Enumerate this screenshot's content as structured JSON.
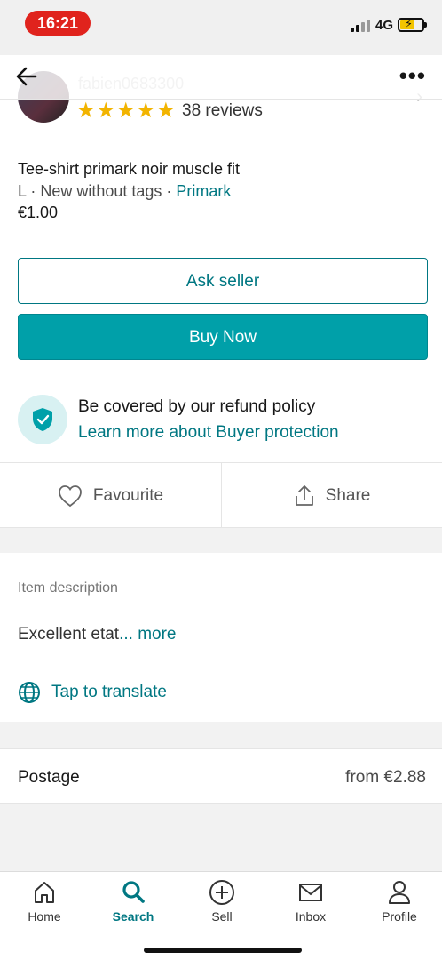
{
  "status": {
    "time": "16:21",
    "network": "4G"
  },
  "seller": {
    "username": "fabien0683300",
    "stars": "★★★★★",
    "reviews": "38 reviews"
  },
  "item": {
    "title": "Tee-shirt primark noir muscle fit",
    "size": "L",
    "condition": "New without tags",
    "brand": "Primark",
    "price": "€1.00"
  },
  "buttons": {
    "ask_seller": "Ask seller",
    "buy_now": "Buy Now"
  },
  "protection": {
    "title": "Be covered by our refund policy",
    "link": "Learn more about Buyer protection"
  },
  "actions": {
    "favourite": "Favourite",
    "share": "Share"
  },
  "description": {
    "label": "Item description",
    "text": "Excellent etat",
    "ellipsis": "...",
    "more": " more"
  },
  "translate": "Tap to translate",
  "postage": {
    "label": "Postage",
    "value": "from €2.88"
  },
  "tabs": [
    {
      "label": "Home",
      "icon": "home-icon"
    },
    {
      "label": "Search",
      "icon": "search-icon",
      "active": true
    },
    {
      "label": "Sell",
      "icon": "plus-circle-icon"
    },
    {
      "label": "Inbox",
      "icon": "mail-icon"
    },
    {
      "label": "Profile",
      "icon": "profile-icon"
    }
  ],
  "colors": {
    "accent": "#007782",
    "buy_button": "#00a0a9",
    "stars": "#f2b400",
    "time_pill": "#e0231d"
  }
}
